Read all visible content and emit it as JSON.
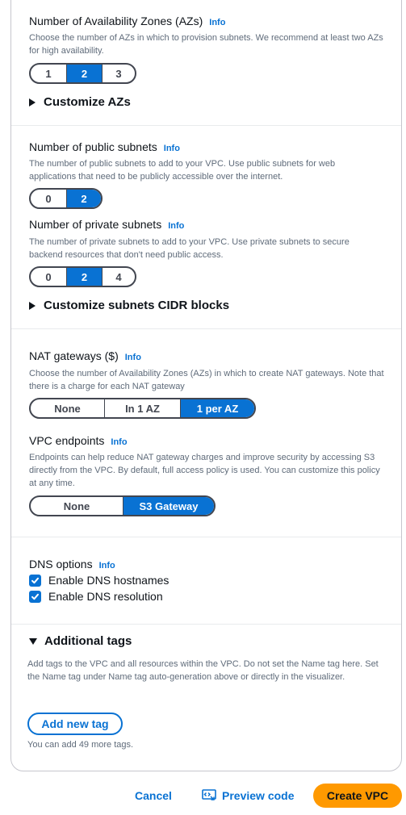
{
  "azs": {
    "label": "Number of Availability Zones (AZs)",
    "info": "Info",
    "description": "Choose the number of AZs in which to provision subnets. We recommend at least two AZs for high availability.",
    "options": [
      "1",
      "2",
      "3"
    ],
    "selected": "2",
    "customize": "Customize AZs"
  },
  "public_subnets": {
    "label": "Number of public subnets",
    "info": "Info",
    "description": "The number of public subnets to add to your VPC. Use public subnets for web applications that need to be publicly accessible over the internet.",
    "options": [
      "0",
      "2"
    ],
    "selected": "2"
  },
  "private_subnets": {
    "label": "Number of private subnets",
    "info": "Info",
    "description": "The number of private subnets to add to your VPC. Use private subnets to secure backend resources that don't need public access.",
    "options": [
      "0",
      "2",
      "4"
    ],
    "selected": "2",
    "customize": "Customize subnets CIDR blocks"
  },
  "nat": {
    "label": "NAT gateways ($)",
    "info": "Info",
    "description": "Choose the number of Availability Zones (AZs) in which to create NAT gateways. Note that there is a charge for each NAT gateway",
    "options": [
      "None",
      "In 1 AZ",
      "1 per AZ"
    ],
    "selected": "1 per AZ"
  },
  "endpoints": {
    "label": "VPC endpoints",
    "info": "Info",
    "description": "Endpoints can help reduce NAT gateway charges and improve security by accessing S3 directly from the VPC. By default, full access policy is used. You can customize this policy at any time.",
    "options": [
      "None",
      "S3 Gateway"
    ],
    "selected": "S3 Gateway"
  },
  "dns": {
    "label": "DNS options",
    "info": "Info",
    "hostnames": "Enable DNS hostnames",
    "resolution": "Enable DNS resolution",
    "hostnames_checked": true,
    "resolution_checked": true
  },
  "tags": {
    "title": "Additional tags",
    "description": "Add tags to the VPC and all resources within the VPC. Do not set the Name tag here. Set the Name tag under Name tag auto-generation above or directly in the visualizer.",
    "add_button": "Add new tag",
    "remaining": "You can add 49 more tags."
  },
  "footer": {
    "cancel": "Cancel",
    "preview": "Preview code",
    "create": "Create VPC"
  },
  "colors": {
    "accent": "#0972d3",
    "primary_button": "#ff9900",
    "text_secondary": "#5f6b7a"
  }
}
